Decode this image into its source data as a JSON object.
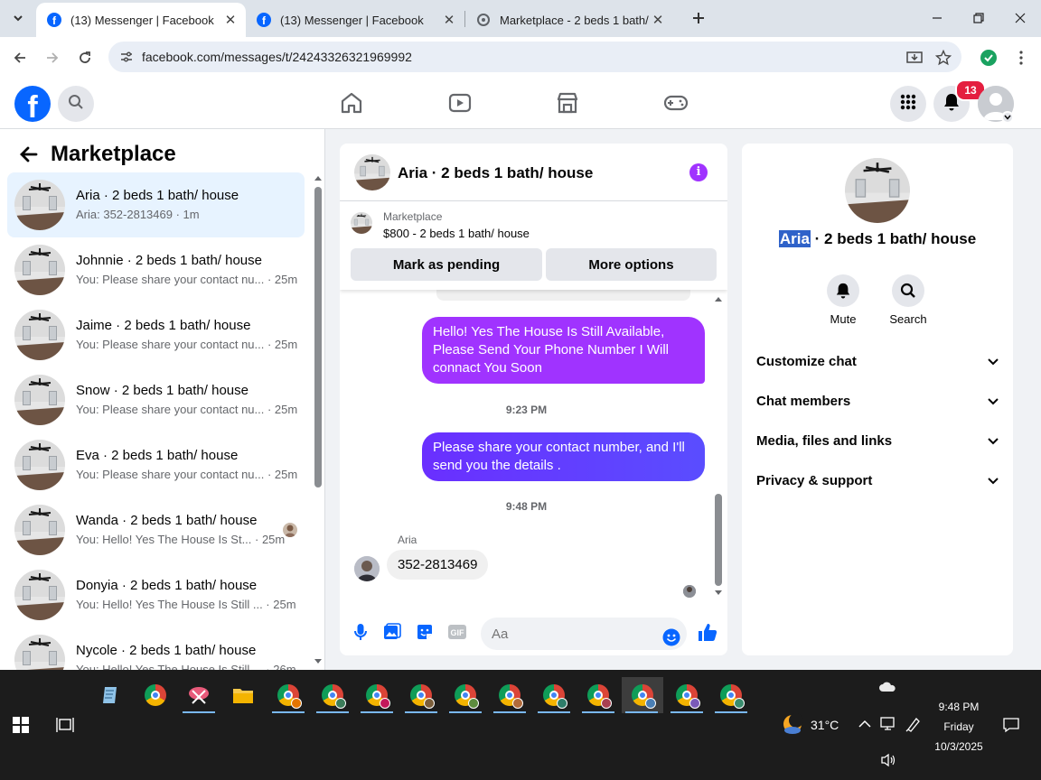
{
  "browser": {
    "tabs": [
      {
        "title": "(13) Messenger | Facebook",
        "active": true
      },
      {
        "title": "(13) Messenger | Facebook",
        "active": false
      },
      {
        "title": "Marketplace - 2 beds 1 bath/ house",
        "active": false
      }
    ],
    "url": "facebook.com/messages/t/24243326321969992"
  },
  "header": {
    "notification_count": "13"
  },
  "sidebar": {
    "title": "Marketplace",
    "conversations": [
      {
        "name": "Aria · 2 beds 1 bath/ house",
        "preview": "Aria: 352-2813469 · 1m",
        "selected": true
      },
      {
        "name": "Johnnie · 2 beds 1 bath/ house",
        "preview": "You: Please share your contact nu... · 25m"
      },
      {
        "name": "Jaime · 2 beds 1 bath/ house",
        "preview": "You: Please share your contact nu... · 25m"
      },
      {
        "name": "Snow · 2 beds 1 bath/ house",
        "preview": "You: Please share your contact nu... · 25m"
      },
      {
        "name": "Eva · 2 beds 1 bath/ house",
        "preview": "You: Please share your contact nu... · 25m"
      },
      {
        "name": "Wanda · 2 beds 1 bath/ house",
        "preview": "You: Hello! Yes The House Is St... · 25m"
      },
      {
        "name": "Donyia · 2 beds 1 bath/ house",
        "preview": "You: Hello! Yes The House Is Still ... · 25m"
      },
      {
        "name": "Nycole · 2 beds 1 bath/ house",
        "preview": "You: Hello! Yes The House Is Still ... · 26m"
      }
    ]
  },
  "chat": {
    "title": "Aria · 2 beds 1 bath/ house",
    "listing": {
      "source": "Marketplace",
      "title": "$800 - 2 beds 1 bath/ house",
      "pending_button": "Mark as pending",
      "options_button": "More options"
    },
    "messages": [
      {
        "text": "Hello! Yes The House  Is Still Available, Please Send Your Phone Number I Will connact You Soon"
      },
      {
        "time": "9:23 PM"
      },
      {
        "text": "Please share your contact number, and I'll send you the details ."
      },
      {
        "time": "9:48 PM"
      },
      {
        "sender": "Aria",
        "text": "352-2813469"
      }
    ],
    "input_placeholder": "Aa"
  },
  "info_panel": {
    "name_highlight": "Aria",
    "name_rest": " · 2 beds 1 bath/ house",
    "actions": [
      {
        "label": "Mute"
      },
      {
        "label": "Search"
      }
    ],
    "sections": [
      {
        "label": "Customize chat"
      },
      {
        "label": "Chat members"
      },
      {
        "label": "Media, files and links"
      },
      {
        "label": "Privacy & support"
      }
    ]
  },
  "taskbar": {
    "weather": "31°C",
    "time": "9:48 PM",
    "day": "Friday",
    "date": "10/3/2025"
  },
  "colors": {
    "facebook_blue": "#0866ff",
    "messenger_purple": "#a033ff",
    "selected_bg": "#e7f3ff"
  }
}
